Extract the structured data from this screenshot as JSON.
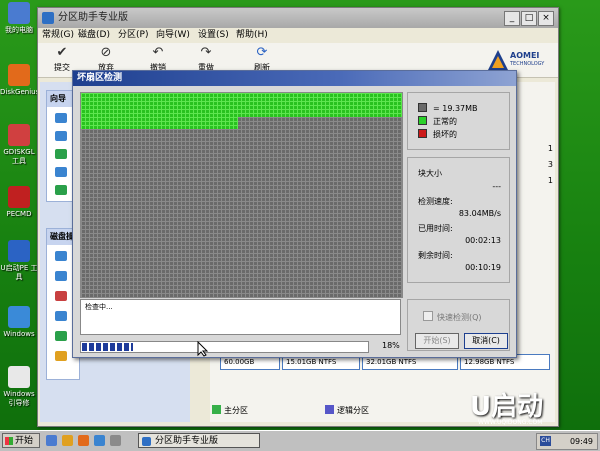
{
  "desktop_icons": [
    {
      "label": "我的电脑",
      "color": "#4a7bd0"
    },
    {
      "label": "DiskGenius",
      "color": "#e26a1b"
    },
    {
      "label": "GDISKGL 工具",
      "color": "#d04040"
    },
    {
      "label": "PECMD",
      "color": "#c02020"
    },
    {
      "label": "U启动PE 工具",
      "color": "#2b63c4"
    },
    {
      "label": "Windows",
      "color": "#3a8ad8"
    },
    {
      "label": "Windows 引导修",
      "color": "#e8e8e8"
    }
  ],
  "window": {
    "title": "分区助手专业版",
    "min": "_",
    "max": "□",
    "close": "×"
  },
  "menu": [
    "常规(G)",
    "磁盘(D)",
    "分区(P)",
    "向导(W)",
    "设置(S)",
    "帮助(H)"
  ],
  "toolbar": [
    {
      "label": "提交",
      "icon": "check-icon"
    },
    {
      "label": "放弃",
      "icon": "discard-icon"
    },
    {
      "label": "撤销",
      "icon": "undo-icon"
    },
    {
      "label": "重做",
      "icon": "redo-icon"
    },
    {
      "label": "刷新",
      "icon": "refresh-icon"
    }
  ],
  "brand": {
    "name": "AOMEI",
    "sub": "TECHNOLOGY"
  },
  "left_panel": {
    "wizard_header": "向导",
    "disk_header": "磁盘操"
  },
  "right_numbers": [
    "1",
    "3",
    "1"
  ],
  "disk_map": [
    "60.00GB",
    "15.01GB NTFS",
    "32.01GB NTFS",
    "12.98GB NTFS"
  ],
  "legend_bottom": [
    {
      "label": "主分区",
      "color": "#36b04a"
    },
    {
      "label": "逻辑分区",
      "color": "#5656c8"
    }
  ],
  "logo": {
    "text": "U启动",
    "url": "WWW.UQIDONG.COM"
  },
  "dialog": {
    "title": "坏扇区检测",
    "legend": [
      {
        "label": "= 19.37MB",
        "color": "#6a6a6a"
      },
      {
        "label": "正常的",
        "color": "#2ad12a"
      },
      {
        "label": "损坏的",
        "color": "#cc1a1a"
      }
    ],
    "stats": {
      "block_size_label": "块大小",
      "block_size_value": "---",
      "speed_label": "检测速度:",
      "speed_value": "83.04MB/s",
      "elapsed_label": "已用时间:",
      "elapsed_value": "00:02:13",
      "remaining_label": "剩余时间:",
      "remaining_value": "00:10:19"
    },
    "log_text": "检查中...",
    "progress_percent": 18,
    "progress_text": "18%",
    "quick_check_label": "快速检测(Q)",
    "start_button": "开始(S)",
    "cancel_button": "取消(C)",
    "grid_rows": 51,
    "grid_cols": 80,
    "checked_fraction": 0.18
  },
  "taskbar": {
    "start": "开始",
    "task_label": "分区助手专业版",
    "lang": "CH",
    "time": "09:49"
  }
}
